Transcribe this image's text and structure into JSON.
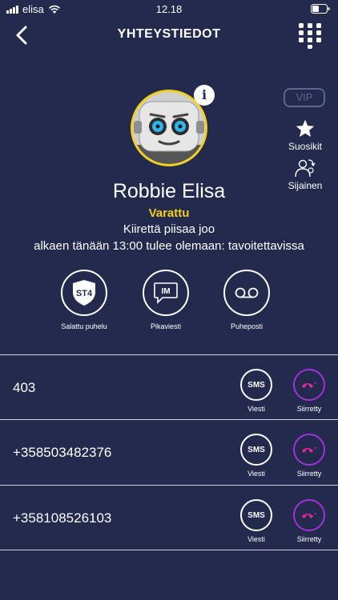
{
  "status_bar": {
    "carrier": "elisa",
    "time": "12.18"
  },
  "header": {
    "title": "YHTEYSTIEDOT"
  },
  "contact": {
    "name": "Robbie Elisa",
    "presence": "Varattu",
    "status_message": "Kiirettä piisaa joo",
    "future_status": "alkaen tänään 13:00 tulee olemaan: tavoitettavissa",
    "info_badge": "i"
  },
  "side_actions": {
    "vip": "VIP",
    "favorites": "Suosikit",
    "location": "Sijainen"
  },
  "actions": [
    {
      "label": "Salattu puhelu",
      "icon": "st4-shield-icon",
      "icon_text": "ST4"
    },
    {
      "label": "Pikaviesti",
      "icon": "im-bubble-icon",
      "icon_text": "IM"
    },
    {
      "label": "Puheposti",
      "icon": "voicemail-icon"
    }
  ],
  "numbers": [
    {
      "number": "403",
      "sms": "SMS",
      "sms_label": "Viesti",
      "forward_label": "Siirretty"
    },
    {
      "number": "+358503482376",
      "sms": "SMS",
      "sms_label": "Viesti",
      "forward_label": "Siirretty"
    },
    {
      "number": "+358108526103",
      "sms": "SMS",
      "sms_label": "Viesti",
      "forward_label": "Siirretty"
    }
  ],
  "colors": {
    "background": "#232a4d",
    "presence": "#f3cf1f",
    "forward": "#a032d8",
    "vip": "#5d6591"
  }
}
